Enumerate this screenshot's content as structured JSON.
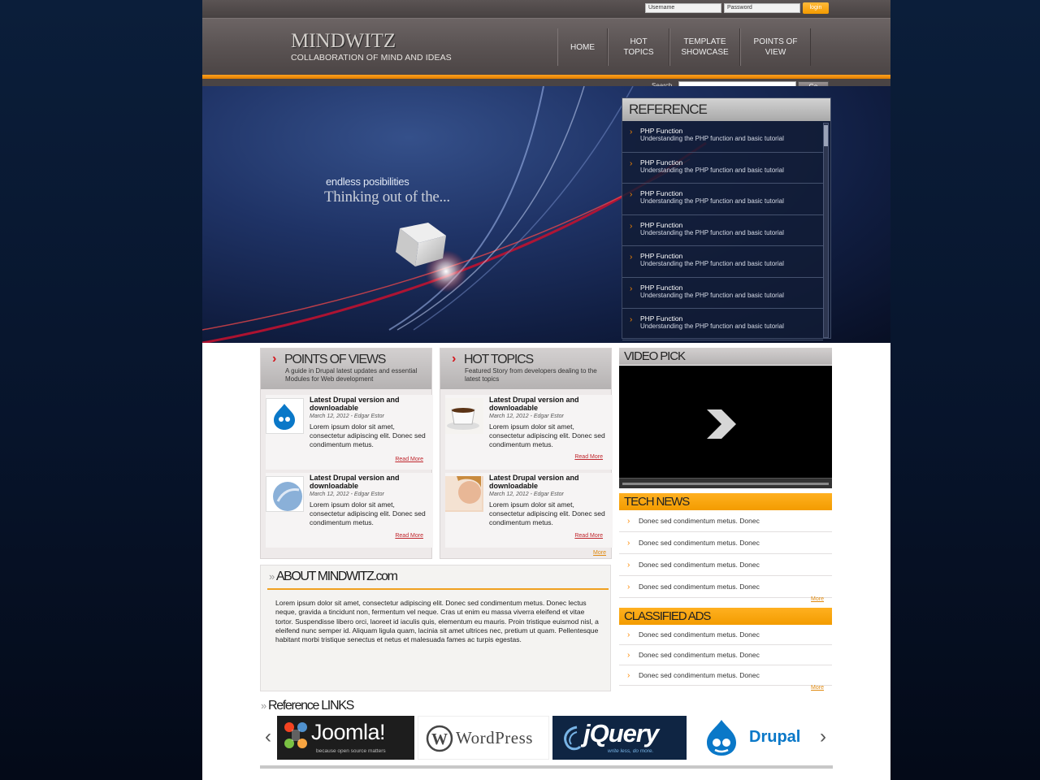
{
  "login": {
    "username_placeholder": "Username",
    "password_placeholder": "Password",
    "login_label": "login"
  },
  "brand": {
    "title": "MINDWITZ",
    "subtitle": "COLLABORATION OF MIND AND IDEAS"
  },
  "nav": {
    "items": [
      {
        "label": "HOME"
      },
      {
        "label": "HOT TOPICS"
      },
      {
        "label": "TEMPLATE\nSHOWCASE"
      },
      {
        "label": "POINTS OF\nVIEW"
      }
    ]
  },
  "search": {
    "label": "Search",
    "button": "Go"
  },
  "hero": {
    "tagline_small": "endless posibilities",
    "tagline_large": "Thinking out of the..."
  },
  "reference": {
    "title": "REFERENCE",
    "items": [
      {
        "title": "PHP Function",
        "desc": "Understanding the PHP function and basic tutorial"
      },
      {
        "title": "PHP Function",
        "desc": "Understanding the PHP function and basic tutorial"
      },
      {
        "title": "PHP Function",
        "desc": "Understanding the PHP function and basic tutorial"
      },
      {
        "title": "PHP Function",
        "desc": "Understanding the PHP function and basic tutorial"
      },
      {
        "title": "PHP Function",
        "desc": "Understanding the PHP function and basic tutorial"
      },
      {
        "title": "PHP Function",
        "desc": "Understanding the PHP function and basic tutorial"
      },
      {
        "title": "PHP Function",
        "desc": "Understanding the PHP function and basic tutorial"
      }
    ]
  },
  "points_of_views": {
    "title": "POINTS OF VIEWS",
    "desc": "A guide in Drupal latest updates and essential Modules for Web development",
    "articles": [
      {
        "title": "Latest Drupal version and downloadable",
        "meta": "March 12, 2012 - Edgar Estor",
        "body": "Lorem ipsum dolor sit amet, consectetur adipiscing elit. Donec sed condimentum metus.",
        "read_more": "Read More"
      },
      {
        "title": "Latest Drupal version and downloadable",
        "meta": "March 12, 2012 - Edgar Estor",
        "body": "Lorem ipsum dolor sit amet, consectetur adipiscing elit. Donec sed condimentum metus.",
        "read_more": "Read More"
      }
    ]
  },
  "hot_topics": {
    "title": "HOT TOPICS",
    "desc": "Featured Story from developers dealing to the latest topics",
    "articles": [
      {
        "title": "Latest Drupal version and downloadable",
        "meta": "March 12, 2012 - Edgar Estor",
        "body": "Lorem ipsum dolor sit amet, consectetur adipiscing elit. Donec sed condimentum metus.",
        "read_more": "Read More"
      },
      {
        "title": "Latest Drupal version and downloadable",
        "meta": "March 12, 2012 - Edgar Estor",
        "body": "Lorem ipsum dolor sit amet, consectetur adipiscing elit. Donec sed condimentum metus.",
        "read_more": "Read More"
      }
    ],
    "more": "More"
  },
  "video": {
    "title": "VIDEO PICK"
  },
  "tech_news": {
    "title": "TECH NEWS",
    "items": [
      "Donec sed condimentum metus. Donec",
      "Donec sed condimentum metus. Donec",
      "Donec sed condimentum metus. Donec",
      "Donec sed condimentum metus. Donec"
    ],
    "more": "More"
  },
  "classified_ads": {
    "title": "CLASSIFIED ADS",
    "items": [
      "Donec sed condimentum metus. Donec",
      "Donec sed condimentum metus. Donec",
      "Donec sed condimentum metus. Donec"
    ],
    "more": "More"
  },
  "about": {
    "title": "ABOUT MINDWITZ.com",
    "text": "Lorem ipsum dolor sit amet, consectetur adipiscing elit. Donec sed condimentum metus. Donec lectus neque, gravida a tincidunt non, fermentum vel neque. Cras ut enim eu massa viverra eleifend et vitae tortor. Suspendisse libero orci, laoreet id iaculis quis, elementum eu mauris. Proin tristique euismod nisl, a eleifend nunc semper id. Aliquam ligula quam, lacinia sit amet ultrices nec, pretium ut quam. Pellentesque habitant morbi tristique senectus et netus et malesuada fames ac turpis egestas."
  },
  "reference_links": {
    "title": "Reference LINKS",
    "logos": [
      {
        "name": "Joomla!",
        "tagline": "because open source matters"
      },
      {
        "name": "WordPress"
      },
      {
        "name": "jQuery",
        "tagline": "write less, do more."
      },
      {
        "name": "Drupal"
      }
    ]
  },
  "colors": {
    "accent_orange": "#f5a623",
    "accent_red": "#d5151c",
    "header_gray": "#5a5353",
    "hero_navy": "#101d40"
  }
}
